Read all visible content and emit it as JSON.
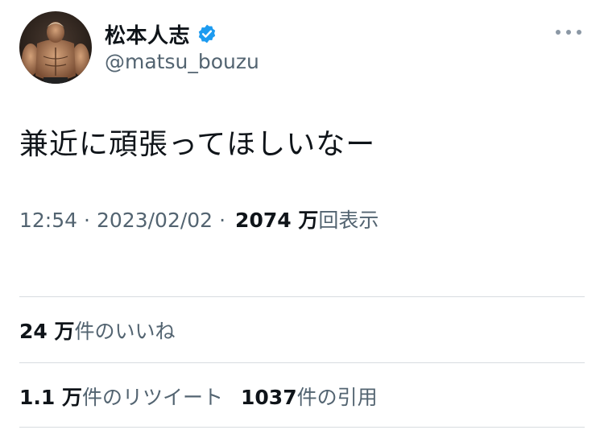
{
  "author": {
    "display_name": "松本人志",
    "handle": "@matsu_bouzu",
    "verified": true,
    "verified_color": "#1d9bf0"
  },
  "tweet": {
    "text": "兼近に頑張ってほしいなー"
  },
  "meta": {
    "time": "12:54",
    "separator": "·",
    "date": "2023/02/02",
    "views_count": "2074 万",
    "views_label": "回表示"
  },
  "stats": {
    "likes_count": "24 万",
    "likes_label": "件のいいね",
    "retweets_count": "1.1 万",
    "retweets_label": "件のリツイート",
    "quotes_count": "1037",
    "quotes_label": "件の引用"
  },
  "icons": {
    "more": "more-icon",
    "verified": "verified-badge-icon",
    "avatar": "avatar"
  },
  "colors": {
    "primary_text": "#0f1419",
    "secondary_text": "#536471",
    "divider": "#d7dce0"
  }
}
